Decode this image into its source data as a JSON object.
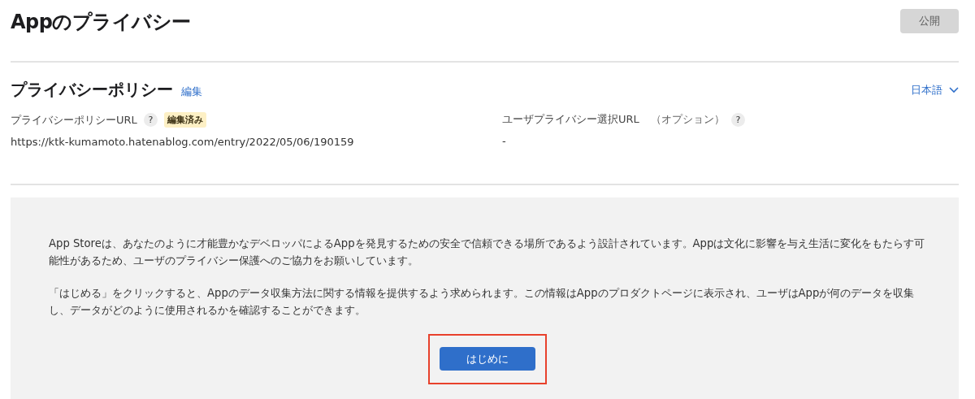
{
  "page": {
    "title": "Appのプライバシー",
    "publish_button": {
      "label": "公開",
      "disabled": true
    }
  },
  "privacy_policy": {
    "heading": "プライバシーポリシー",
    "edit_link": "編集",
    "language": "日本語",
    "fields": [
      {
        "label": "プライバシーポリシーURL",
        "help": "?",
        "badge": "編集済み",
        "value": "https://ktk-kumamoto.hatenablog.com/entry/2022/05/06/190159"
      },
      {
        "label": "ユーザプライバシー選択URL",
        "optional_note": "（オプション）",
        "help": "?",
        "value": "-"
      }
    ]
  },
  "info_panel": {
    "paragraphs": [
      "App Storeは、あなたのように才能豊かなデベロッパによるAppを発見するための安全で信頼できる場所であるよう設計されています。Appは文化に影響を与え生活に変化をもたらす可能性があるため、ユーザのプライバシー保護へのご協力をお願いしています。",
      "「はじめる」をクリックすると、Appのデータ収集方法に関する情報を提供するよう求められます。この情報はAppのプロダクトページに表示され、ユーザはAppが何のデータを収集し、データがどのように使用されるかを確認することができます。"
    ],
    "start_button": {
      "label": "はじめに",
      "highlighted": true
    }
  }
}
